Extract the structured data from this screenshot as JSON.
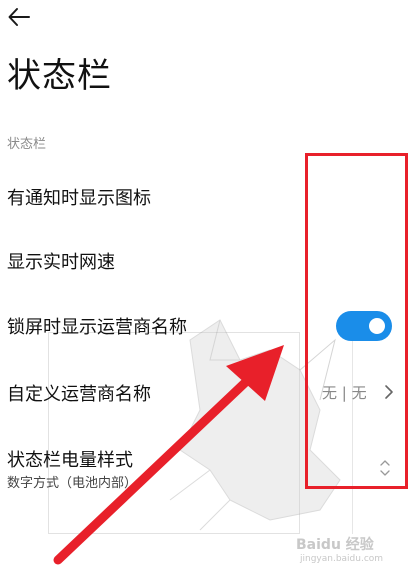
{
  "header": {
    "back_icon": "arrow-left-icon",
    "title": "状态栏"
  },
  "section": {
    "label": "状态栏"
  },
  "settings": [
    {
      "label": "有通知时显示图标"
    },
    {
      "label": "显示实时网速"
    },
    {
      "label": "锁屏时显示运营商名称",
      "toggle_on": true
    },
    {
      "label": "自定义运营商名称",
      "value": "无 | 无",
      "chevron_icon": "chevron-right-icon"
    },
    {
      "label": "状态栏电量样式",
      "sub": "数字方式（电池内部）",
      "icon": "up-down-icon"
    }
  ],
  "watermark": {
    "logo": "Baidu 经验",
    "url": "jingyan.baidu.com"
  },
  "annotation": {
    "highlight_color": "#e8202a",
    "arrow_color": "#e8202a"
  },
  "colors": {
    "toggle_on": "#1a8de9",
    "text_primary": "#111111",
    "text_secondary": "#8a8a8a"
  }
}
